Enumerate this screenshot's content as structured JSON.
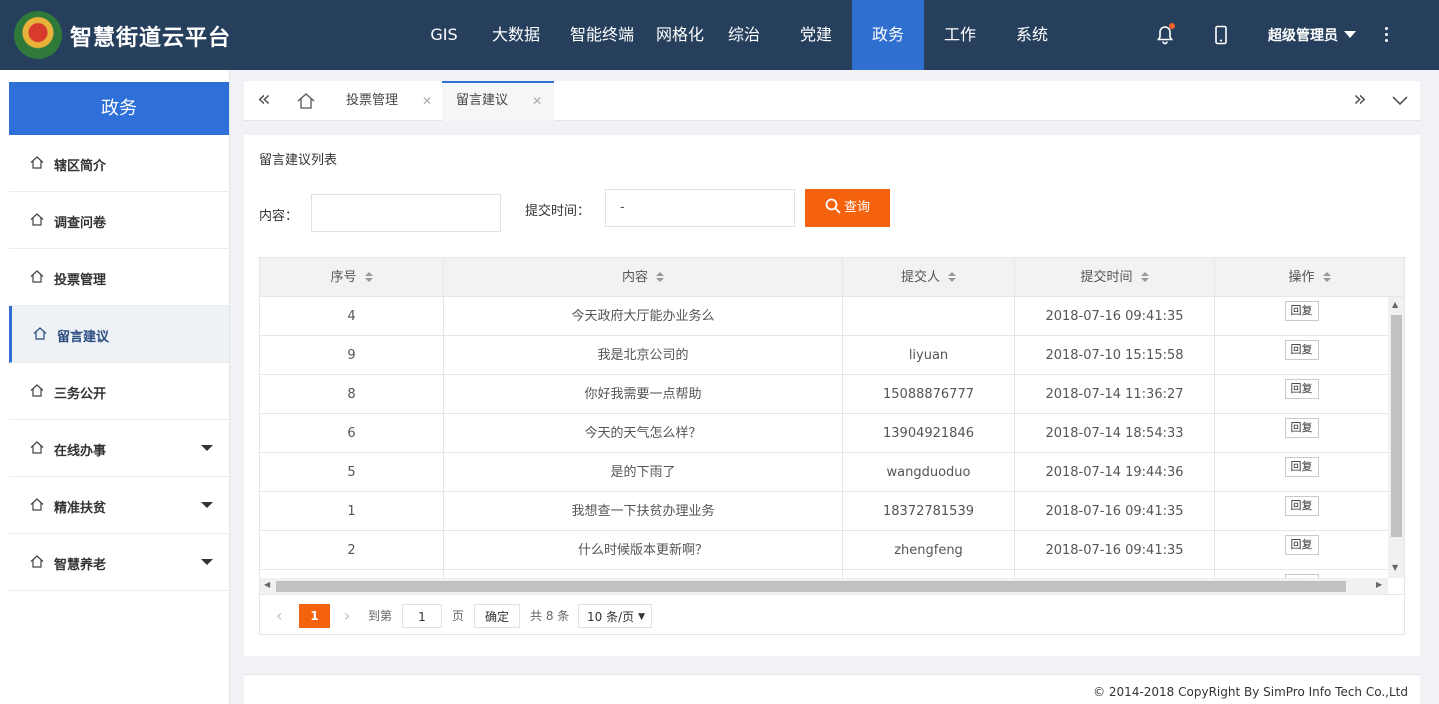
{
  "app": {
    "title": "智慧街道云平台"
  },
  "topnav": {
    "items": [
      "GIS",
      "大数据",
      "智能终端",
      "网格化",
      "综治",
      "党建",
      "政务",
      "工作",
      "系统"
    ],
    "active_index": 6,
    "user": "超级管理员"
  },
  "sidebar": {
    "title": "政务",
    "items": [
      {
        "label": "辖区简介",
        "expandable": false
      },
      {
        "label": "调查问卷",
        "expandable": false
      },
      {
        "label": "投票管理",
        "expandable": false
      },
      {
        "label": "留言建议",
        "expandable": false,
        "active": true
      },
      {
        "label": "三务公开",
        "expandable": false
      },
      {
        "label": "在线办事",
        "expandable": true
      },
      {
        "label": "精准扶贫",
        "expandable": true
      },
      {
        "label": "智慧养老",
        "expandable": true
      }
    ]
  },
  "tabs": [
    {
      "label": "投票管理",
      "active": false
    },
    {
      "label": "留言建议",
      "active": true
    }
  ],
  "panel": {
    "title": "留言建议列表",
    "filters": {
      "content_label": "内容：",
      "content_value": "",
      "time_label": "提交时间：",
      "time_value": "-",
      "query_button": "查询"
    }
  },
  "table": {
    "columns": [
      "序号",
      "内容",
      "提交人",
      "提交时间",
      "操作"
    ],
    "reply_label": "回复",
    "rows": [
      {
        "id": "4",
        "content": "今天政府大厅能办业务么",
        "submitter": "",
        "time": "2018-07-16 09:41:35"
      },
      {
        "id": "9",
        "content": "我是北京公司的",
        "submitter": "liyuan",
        "time": "2018-07-10 15:15:58"
      },
      {
        "id": "8",
        "content": "你好我需要一点帮助",
        "submitter": "15088876777",
        "time": "2018-07-14 11:36:27"
      },
      {
        "id": "6",
        "content": "今天的天气怎么样？",
        "submitter": "13904921846",
        "time": "2018-07-14 18:54:33"
      },
      {
        "id": "5",
        "content": "是的下雨了",
        "submitter": "wangduoduo",
        "time": "2018-07-14 19:44:36"
      },
      {
        "id": "1",
        "content": "我想查一下扶贫办理业务",
        "submitter": "18372781539",
        "time": "2018-07-16 09:41:35"
      },
      {
        "id": "2",
        "content": "什么时候版本更新啊？",
        "submitter": "zhengfeng",
        "time": "2018-07-16 09:41:35"
      },
      {
        "id": "",
        "content": "",
        "submitter": "",
        "time": ""
      }
    ]
  },
  "pagination": {
    "current": "1",
    "goto_label": "到第",
    "goto_value": "1",
    "page_unit": "页",
    "confirm": "确定",
    "total": "共 8 条",
    "page_size": "10 条/页"
  },
  "footer": {
    "copyright": "© 2014-2018 CopyRight By SimPro Info Tech Co.,Ltd"
  },
  "colors": {
    "topbar": "#263f5c",
    "accent": "#2e70d8",
    "orange": "#f5620e"
  }
}
